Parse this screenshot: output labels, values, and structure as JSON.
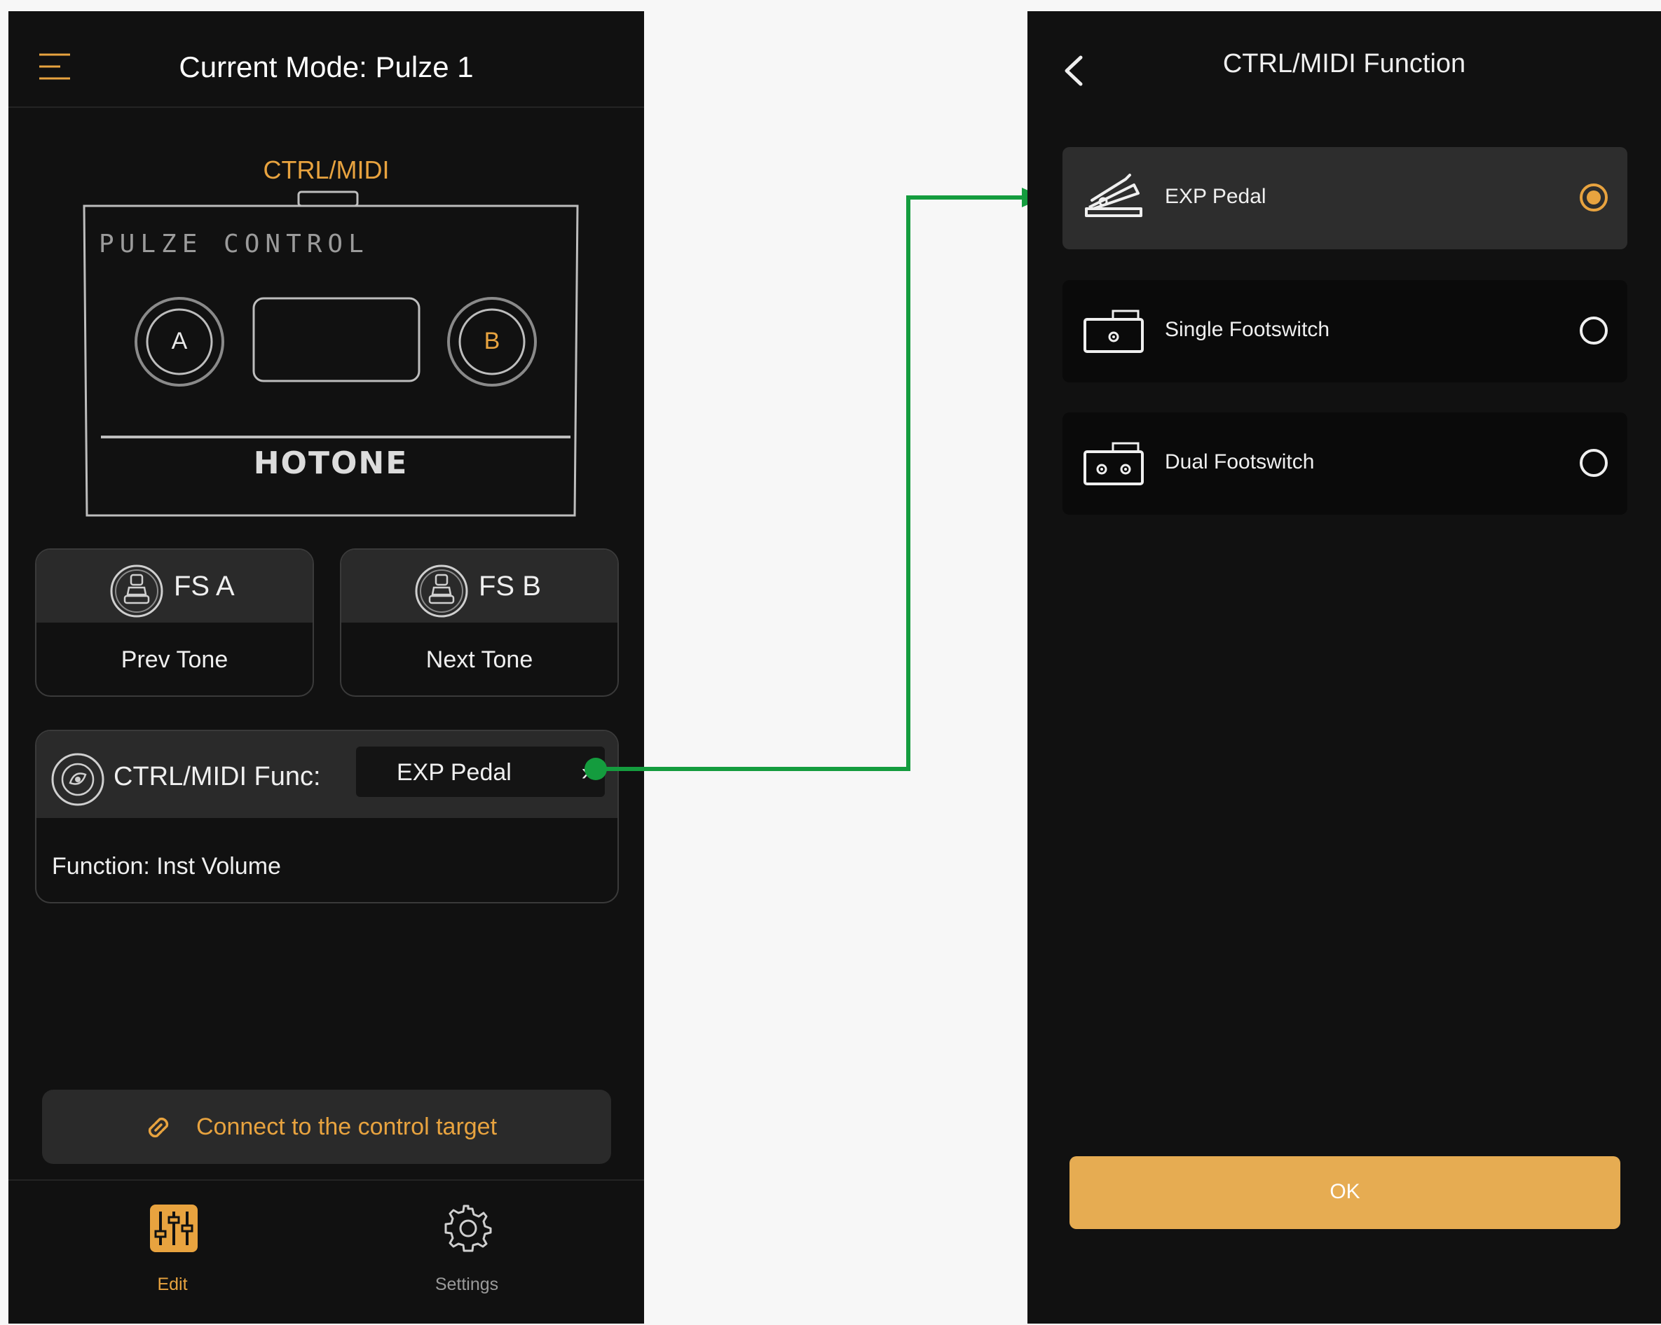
{
  "colors": {
    "accent": "#e8a33f",
    "panel_background": "#111111",
    "card_background": "#2a2a2a",
    "connector_green": "#149c3e",
    "ok_button": "#e6ac52"
  },
  "left_screen": {
    "header": {
      "menu_icon": "hamburger-menu-icon",
      "title": "Current Mode: Pulze 1"
    },
    "ctrl_label": "CTRL/MIDI",
    "device": {
      "brand_text": "PULZE CONTROL",
      "logo_text": "HOTONE",
      "knob_a": "A",
      "knob_b": "B"
    },
    "footswitches": [
      {
        "name": "FS A",
        "function": "Prev Tone",
        "icon": "footswitch-icon"
      },
      {
        "name": "FS B",
        "function": "Next Tone",
        "icon": "footswitch-icon"
      }
    ],
    "ctrl_midi": {
      "label": "CTRL/MIDI Func:",
      "selected": "EXP Pedal",
      "chevron": "›",
      "function_text": "Function: Inst Volume"
    },
    "connect_button": {
      "label": "Connect to the control target",
      "icon": "link-icon"
    },
    "tabbar": [
      {
        "label": "Edit",
        "icon": "sliders-icon",
        "active": true
      },
      {
        "label": "Settings",
        "icon": "gear-icon",
        "active": false
      }
    ]
  },
  "right_screen": {
    "header": {
      "back_icon": "chevron-left-icon",
      "title": "CTRL/MIDI Function"
    },
    "options": [
      {
        "label": "EXP Pedal",
        "icon": "expression-pedal-icon",
        "selected": true
      },
      {
        "label": "Single Footswitch",
        "icon": "single-footswitch-icon",
        "selected": false
      },
      {
        "label": "Dual Footswitch",
        "icon": "dual-footswitch-icon",
        "selected": false
      }
    ],
    "ok_button": "OK"
  }
}
